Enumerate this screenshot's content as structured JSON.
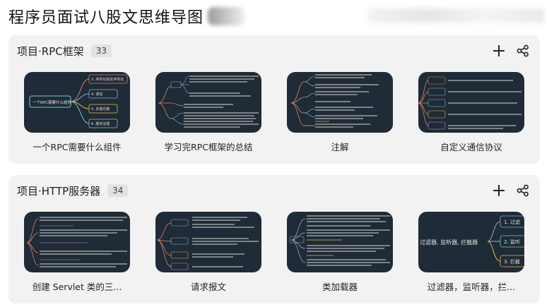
{
  "page": {
    "title": "程序员面试八股文思维导图"
  },
  "sections": [
    {
      "title": "项目·RPC框架",
      "count": "33",
      "cards": [
        {
          "label": "一个RPC需要什么组件",
          "thumb_center": "一个RPC需要什么组件",
          "thumb_branches": [
            "3. 序列化和反序列化",
            "4. 通信",
            "5. 负载均衡",
            "6. 服务治理"
          ]
        },
        {
          "label": "学习完RPC框架的总结"
        },
        {
          "label": "注解"
        },
        {
          "label": "自定义通信协议"
        }
      ]
    },
    {
      "title": "项目·HTTP服务器",
      "count": "34",
      "cards": [
        {
          "label": "创建 Servlet 类的三..."
        },
        {
          "label": "请求报文"
        },
        {
          "label": "类加载器"
        },
        {
          "label": "过滤器，监听器，拦...",
          "thumb_center": "过滤器, 监听器, 拦截器",
          "thumb_branches": [
            "1. 过滤",
            "2. 监听",
            "3. 拦截"
          ]
        }
      ]
    }
  ],
  "icons": {
    "add": "plus-icon",
    "share": "share-icon"
  },
  "colors": {
    "thumb_bg": "#1f2b36",
    "section_bg": "#f2f2f3"
  }
}
